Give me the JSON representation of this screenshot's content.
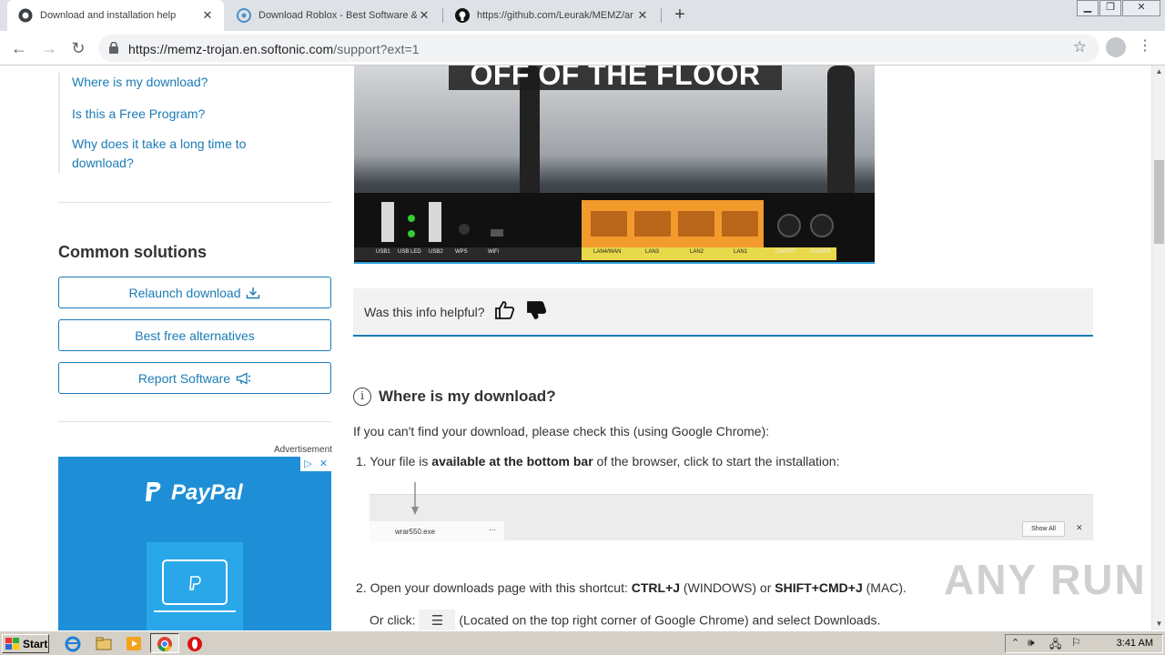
{
  "browser": {
    "tabs": [
      {
        "title": "Download and installation help",
        "active": true,
        "icon": "softonic-icon"
      },
      {
        "title": "Download Roblox - Best Software &",
        "active": false,
        "icon": "softonic-icon"
      },
      {
        "title": "https://github.com/Leurak/MEMZ/ar",
        "active": false,
        "icon": "github-icon"
      }
    ],
    "url_host": "https://memz-trojan.en.softonic.com",
    "url_path": "/support?ext=1"
  },
  "sidebar": {
    "links": [
      "Where is my download?",
      "Is this a Free Program?",
      "Why does it take a long time to download?"
    ],
    "common_solutions_title": "Common solutions",
    "buttons": {
      "relaunch": "Relaunch download",
      "alternatives": "Best free alternatives",
      "report": "Report Software"
    },
    "ad_label": "Advertisement",
    "ad_brand": "PayPal"
  },
  "video": {
    "caption": "OFF OF THE FLOOR",
    "port_labels": [
      "USB1",
      "USB LED",
      "USB2",
      "WPS",
      "WiFi",
      "LAN4/WAN",
      "LAN3",
      "LAN2",
      "LAN1",
      "ON/OFF",
      "POWER"
    ]
  },
  "helpful": {
    "question": "Was this info helpful?"
  },
  "article": {
    "heading": "Where is my download?",
    "intro": "If you can't find your download, please check this (using Google Chrome):",
    "step1_num": "1.",
    "step1_a": "Your file is ",
    "step1_b": "available at the bottom bar",
    "step1_c": " of the browser, click to start the installation:",
    "dl_filename": "wrar550.exe",
    "dl_show_all": "Show All",
    "step2_num": "2.",
    "step2_a": "Open your downloads page with this shortcut: ",
    "step2_b": "CTRL+J",
    "step2_c": " (WINDOWS) or ",
    "step2_d": "SHIFT+CMD+J",
    "step2_e": " (MAC).",
    "step2_or": "Or click: ",
    "step2_rest": " (Located on the top right corner of Google Chrome) and select Downloads."
  },
  "watermark": "ANY RUN",
  "taskbar": {
    "start": "Start",
    "time": "3:41 AM"
  }
}
